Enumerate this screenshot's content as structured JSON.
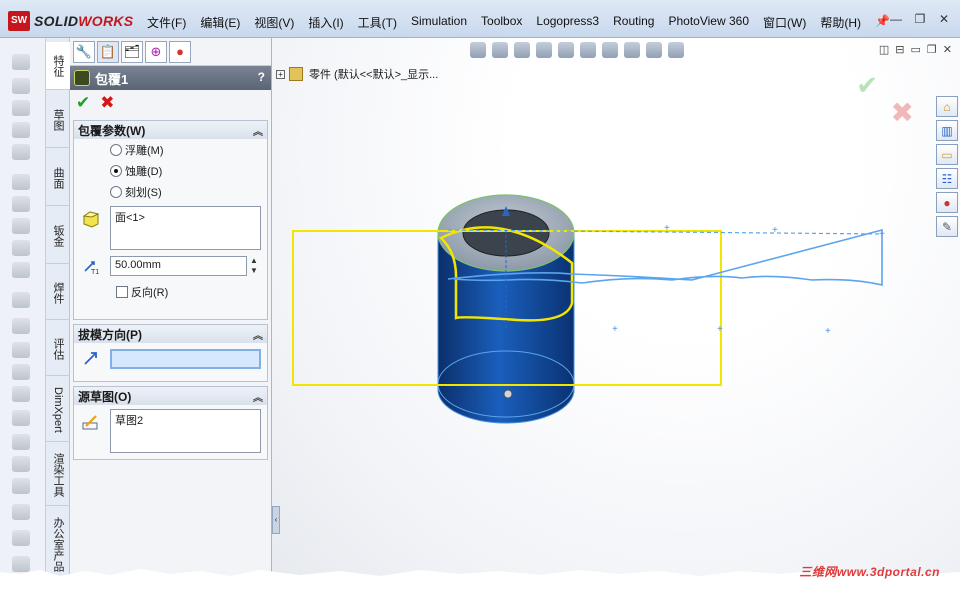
{
  "app": {
    "brand_prefix": "SOLID",
    "brand_suffix": "WORKS",
    "logo_badge": "SW"
  },
  "menu": {
    "items": [
      "文件(F)",
      "编辑(E)",
      "视图(V)",
      "插入(I)",
      "工具(T)",
      "Simulation",
      "Toolbox",
      "Logopress3",
      "Routing",
      "PhotoView 360",
      "窗口(W)",
      "帮助(H)"
    ],
    "pin_icon": "pushpin-icon",
    "window_controls": [
      "minimize-icon",
      "restore-icon",
      "close-icon"
    ]
  },
  "vertical_tabs": [
    "特征",
    "草图",
    "曲面",
    "钣金",
    "焊件",
    "评估",
    "DimXpert",
    "渲染工具",
    "办公室产品"
  ],
  "property_manager": {
    "tab_icons": [
      "feature-manager-icon",
      "property-manager-icon",
      "configuration-manager-icon",
      "dimxpert-manager-icon",
      "display-manager-icon"
    ],
    "title": "包覆1",
    "help": "?",
    "ok_symbol": "✔",
    "cancel_symbol": "✖",
    "wrap_params": {
      "header": "包覆参数(W)",
      "options": [
        {
          "label": "浮雕(M)",
          "selected": false
        },
        {
          "label": "蚀雕(D)",
          "selected": true
        },
        {
          "label": "刻划(S)",
          "selected": false
        }
      ],
      "face_list": [
        "面<1>"
      ],
      "thickness": "50.00mm",
      "reverse_label": "反向(R)",
      "reverse_checked": false
    },
    "pull_direction": {
      "header": "拔模方向(P)",
      "value": ""
    },
    "source_sketch": {
      "header": "源草图(O)",
      "value": "草图2"
    }
  },
  "viewport": {
    "tree_label": "零件  (默认<<默认>_显示...",
    "toolbar_icons": [
      "zoom-to-fit-icon",
      "zoom-area-icon",
      "previous-view-icon",
      "section-view-icon",
      "view-orientation-icon",
      "display-style-icon",
      "hide-show-icon",
      "edit-appearance-icon",
      "apply-scene-icon",
      "view-settings-icon"
    ]
  },
  "task_pane_icons": [
    "home-icon",
    "design-library-icon",
    "file-explorer-icon",
    "view-palette-icon",
    "appearances-icon",
    "custom-properties-icon"
  ],
  "watermark": "三维网www.3dportal.cn",
  "colors": {
    "accent_blue": "#4a90e2",
    "sketch_yellow": "#f2e600",
    "cylinder_blue": "#0e3f86",
    "preview_blue": "#5ba4ee"
  }
}
